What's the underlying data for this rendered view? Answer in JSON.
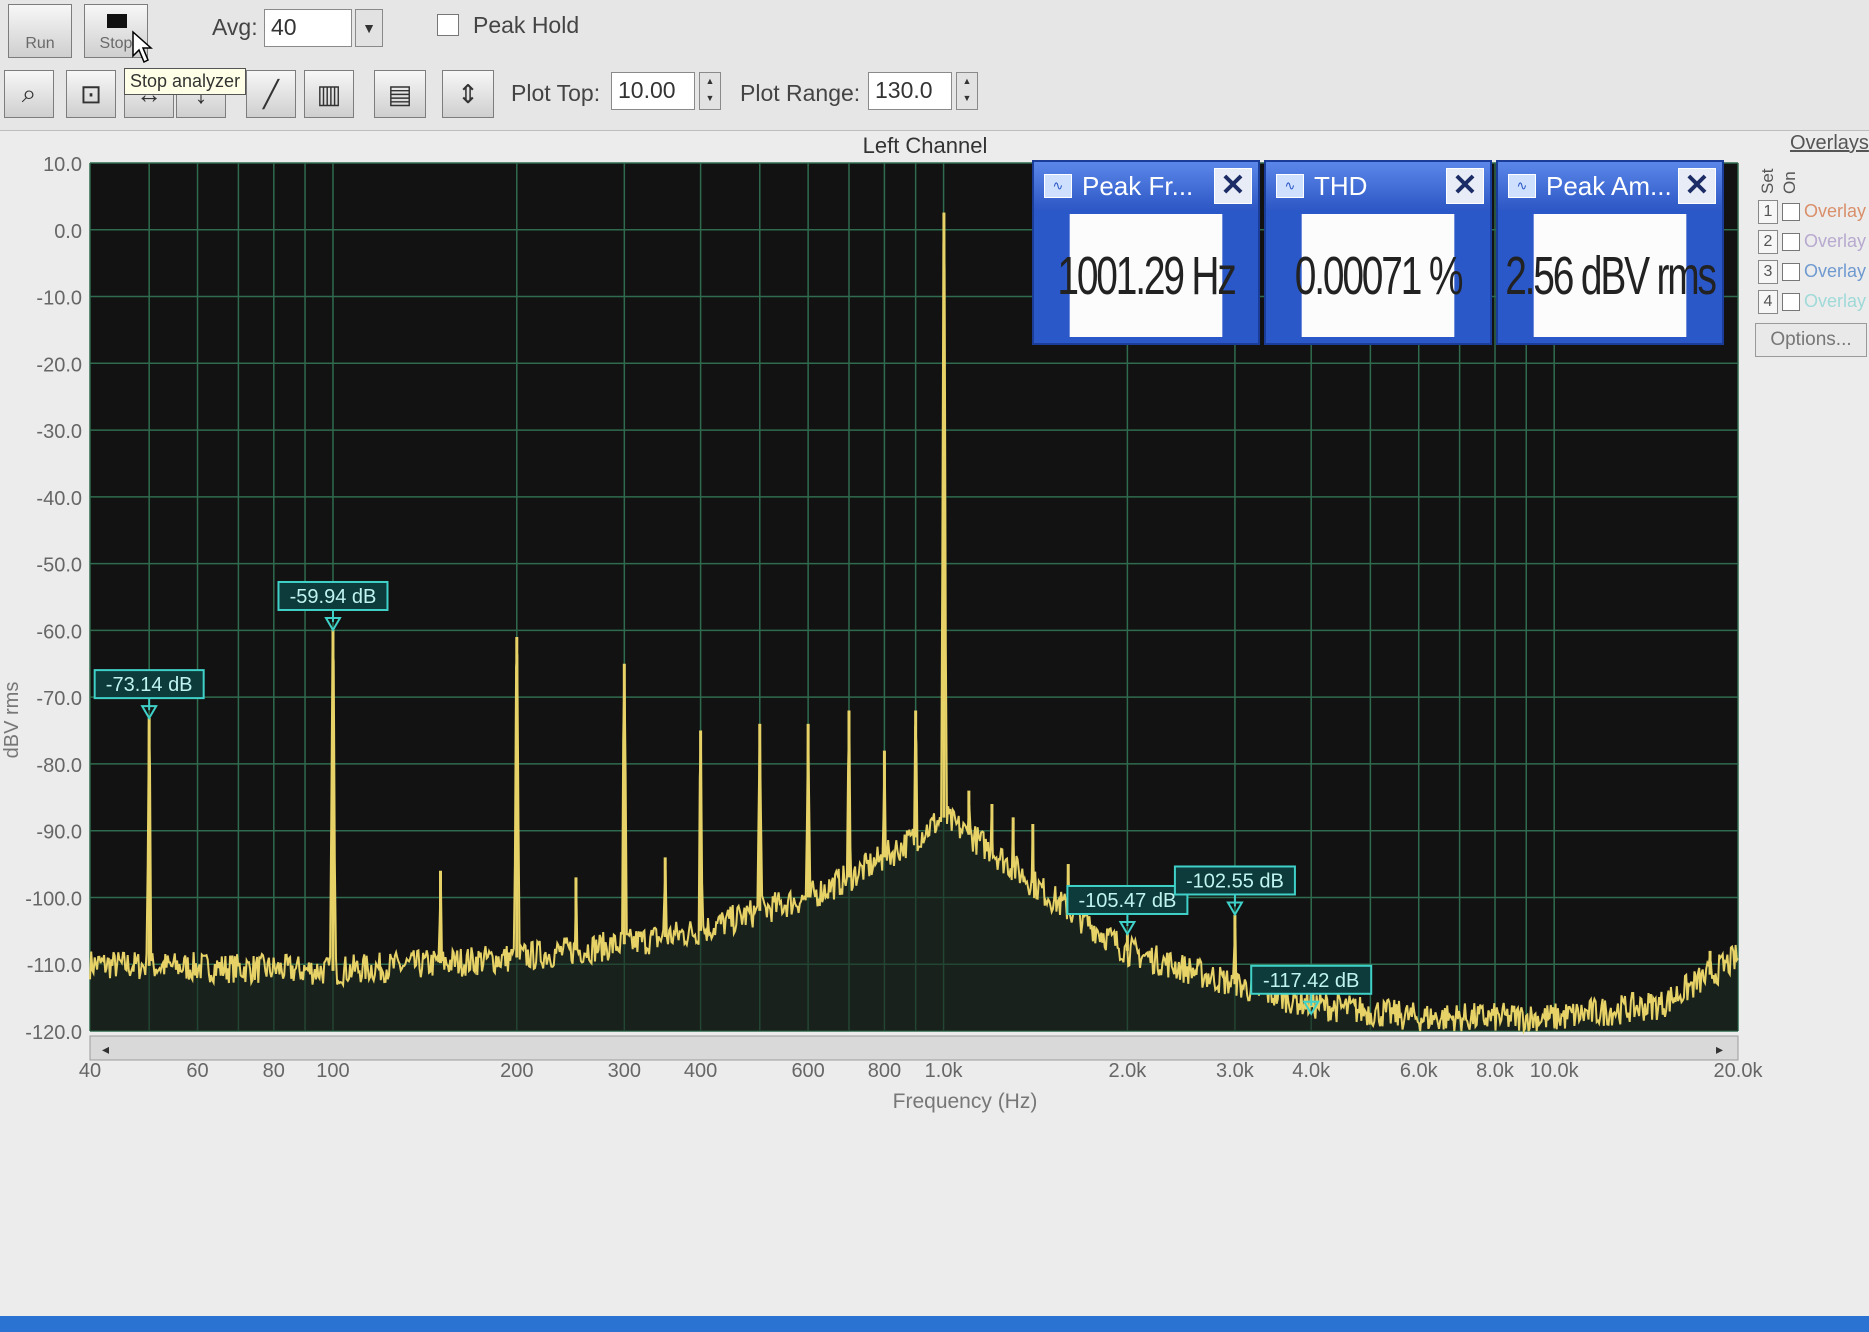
{
  "toolbar": {
    "run_label": "Run",
    "stop_label": "Stop",
    "tooltip": "Stop analyzer",
    "avg_label": "Avg:",
    "avg_value": "40",
    "peak_hold_label": "Peak Hold",
    "peak_hold_checked": false,
    "plot_top_label": "Plot Top:",
    "plot_top_value": "10.00",
    "plot_range_label": "Plot Range:",
    "plot_range_value": "130.0",
    "tool_icons": [
      "zoom-icon",
      "zoom-box-icon",
      "zoom-x-icon",
      "zoom-y-icon",
      "line-plot-icon",
      "bar-plot-icon",
      "table-view-icon",
      "cursor-icon"
    ]
  },
  "meters": [
    {
      "title": "Peak Fr...",
      "value": "1001.29 Hz"
    },
    {
      "title": "THD",
      "value": "0.00071 %"
    },
    {
      "title": "Peak Am...",
      "value": "2.56 dBV rms"
    }
  ],
  "overlay": {
    "title": "Overlays",
    "col_set": "Set",
    "col_on": "On",
    "rows": [
      {
        "num": "1",
        "name": "Overlay",
        "color": "#d98f6a"
      },
      {
        "num": "2",
        "name": "Overlay",
        "color": "#b7a9cf"
      },
      {
        "num": "3",
        "name": "Overlay",
        "color": "#6f9ad0"
      },
      {
        "num": "4",
        "name": "Overlay",
        "color": "#9fdad8"
      }
    ],
    "options_label": "Options..."
  },
  "chart_data": {
    "type": "line",
    "title": "Left Channel",
    "xlabel": "Frequency (Hz)",
    "ylabel": "dBV rms",
    "x_scale": "log",
    "xlim": [
      40,
      20000
    ],
    "ylim": [
      -120,
      10
    ],
    "grid": true,
    "background": "#121212",
    "grid_color": "#2f6b4e",
    "trace_color": "#e6d266",
    "marker_color": "#3fd1c8",
    "y_ticks": [
      "10.0",
      "0.0",
      "-10.0",
      "-20.0",
      "-30.0",
      "-40.0",
      "-50.0",
      "-60.0",
      "-70.0",
      "-80.0",
      "-90.0",
      "-100.0",
      "-110.0",
      "-120.0"
    ],
    "x_ticks": [
      {
        "f": 40,
        "label": "40"
      },
      {
        "f": 60,
        "label": "60"
      },
      {
        "f": 80,
        "label": "80"
      },
      {
        "f": 100,
        "label": "100"
      },
      {
        "f": 200,
        "label": "200"
      },
      {
        "f": 300,
        "label": "300"
      },
      {
        "f": 400,
        "label": "400"
      },
      {
        "f": 600,
        "label": "600"
      },
      {
        "f": 800,
        "label": "800"
      },
      {
        "f": 1000,
        "label": "1.0k"
      },
      {
        "f": 2000,
        "label": "2.0k"
      },
      {
        "f": 3000,
        "label": "3.0k"
      },
      {
        "f": 4000,
        "label": "4.0k"
      },
      {
        "f": 6000,
        "label": "6.0k"
      },
      {
        "f": 8000,
        "label": "8.0k"
      },
      {
        "f": 10000,
        "label": "10.0k"
      },
      {
        "f": 20000,
        "label": "20.0k"
      }
    ],
    "peaks": [
      {
        "f": 50,
        "db": -73.1
      },
      {
        "f": 100,
        "db": -59.9
      },
      {
        "f": 150,
        "db": -96
      },
      {
        "f": 200,
        "db": -61
      },
      {
        "f": 250,
        "db": -97
      },
      {
        "f": 300,
        "db": -65
      },
      {
        "f": 350,
        "db": -94
      },
      {
        "f": 400,
        "db": -75
      },
      {
        "f": 500,
        "db": -74
      },
      {
        "f": 600,
        "db": -74
      },
      {
        "f": 700,
        "db": -72
      },
      {
        "f": 800,
        "db": -78
      },
      {
        "f": 900,
        "db": -72
      },
      {
        "f": 1001.29,
        "db": 2.56
      },
      {
        "f": 1100,
        "db": -84
      },
      {
        "f": 1200,
        "db": -86
      },
      {
        "f": 1300,
        "db": -88
      },
      {
        "f": 1400,
        "db": -89
      },
      {
        "f": 1600,
        "db": -95
      },
      {
        "f": 2000,
        "db": -105.5
      },
      {
        "f": 3000,
        "db": -102.6
      },
      {
        "f": 18000,
        "db": -108
      }
    ],
    "noise_floor": [
      {
        "f": 40,
        "db": -110
      },
      {
        "f": 100,
        "db": -111
      },
      {
        "f": 200,
        "db": -109
      },
      {
        "f": 300,
        "db": -107
      },
      {
        "f": 400,
        "db": -105
      },
      {
        "f": 500,
        "db": -102
      },
      {
        "f": 600,
        "db": -100
      },
      {
        "f": 700,
        "db": -97
      },
      {
        "f": 800,
        "db": -94
      },
      {
        "f": 900,
        "db": -91
      },
      {
        "f": 1000,
        "db": -88
      },
      {
        "f": 1200,
        "db": -93
      },
      {
        "f": 1500,
        "db": -100
      },
      {
        "f": 2000,
        "db": -108
      },
      {
        "f": 3000,
        "db": -113
      },
      {
        "f": 4000,
        "db": -116
      },
      {
        "f": 6000,
        "db": -118
      },
      {
        "f": 10000,
        "db": -118
      },
      {
        "f": 15000,
        "db": -116
      },
      {
        "f": 20000,
        "db": -109
      }
    ],
    "markers": [
      {
        "f": 50,
        "db": -73.14,
        "label": "-73.14 dB"
      },
      {
        "f": 100,
        "db": -59.94,
        "label": "-59.94 dB"
      },
      {
        "f": 2000,
        "db": -105.47,
        "label": "-105.47 dB"
      },
      {
        "f": 3000,
        "db": -102.55,
        "label": "-102.55 dB"
      },
      {
        "f": 4000,
        "db": -117.42,
        "label": "-117.42 dB"
      }
    ]
  }
}
